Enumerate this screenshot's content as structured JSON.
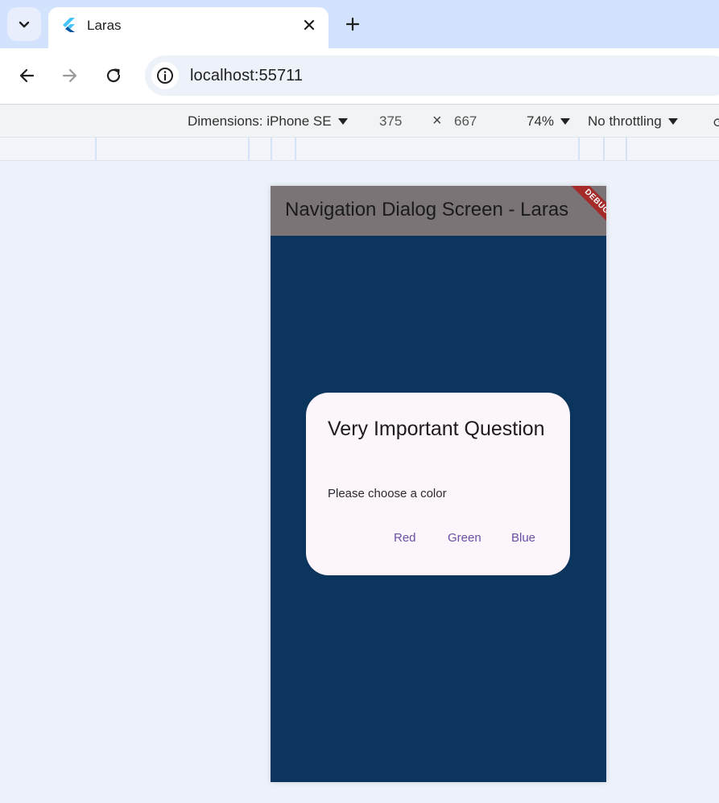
{
  "browser": {
    "tab": {
      "title": "Laras"
    },
    "url": "localhost:55711"
  },
  "devtools": {
    "dimensions_label": "Dimensions: iPhone SE",
    "width": "375",
    "height": "667",
    "times": "×",
    "zoom": "74%",
    "throttling": "No throttling"
  },
  "app": {
    "appbar_title": "Navigation Dialog Screen - Laras",
    "debug_banner": "DEBUG",
    "colors": {
      "background": "#0b355d",
      "appbar": "#7a7477",
      "dialog": "#fdf5fc",
      "button_text": "#6750a4"
    },
    "dialog": {
      "title": "Very Important Question",
      "content": "Please choose a color",
      "buttons": [
        "Red",
        "Green",
        "Blue"
      ]
    }
  },
  "icons": [
    "chevron-down-icon",
    "flutter-icon",
    "close-icon",
    "plus-icon",
    "back-icon",
    "forward-icon",
    "reload-icon",
    "info-icon",
    "rotate-icon"
  ]
}
